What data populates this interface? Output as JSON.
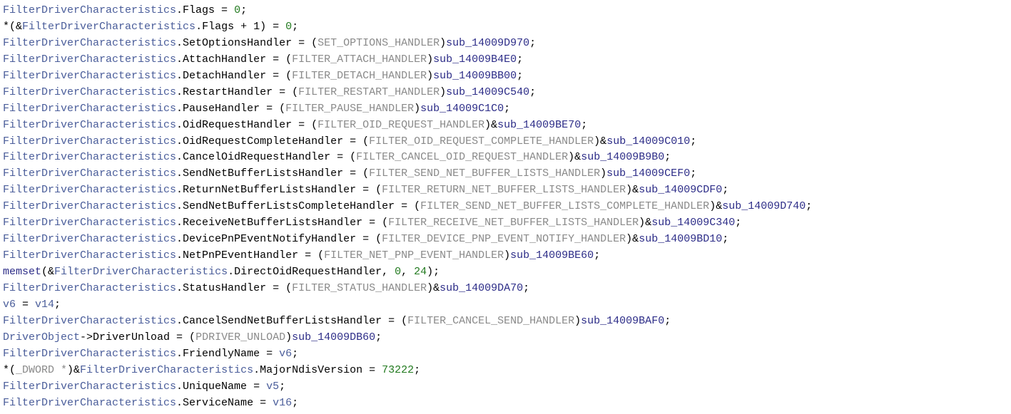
{
  "struct": "FilterDriverCharacteristics",
  "driverobj": "DriverObject",
  "lines": [
    {
      "kind": "assign_num",
      "member": "Flags",
      "value": "0"
    },
    {
      "kind": "ptr_store",
      "expr_pre": "*(&",
      "expr_post": ".Flags + 1) = ",
      "value": "0"
    },
    {
      "kind": "handler",
      "member": "SetOptionsHandler",
      "cast": "SET_OPTIONS_HANDLER",
      "amp": false,
      "sub": "sub_14009D970"
    },
    {
      "kind": "handler",
      "member": "AttachHandler",
      "cast": "FILTER_ATTACH_HANDLER",
      "amp": false,
      "sub": "sub_14009B4E0"
    },
    {
      "kind": "handler",
      "member": "DetachHandler",
      "cast": "FILTER_DETACH_HANDLER",
      "amp": false,
      "sub": "sub_14009BB00"
    },
    {
      "kind": "handler",
      "member": "RestartHandler",
      "cast": "FILTER_RESTART_HANDLER",
      "amp": false,
      "sub": "sub_14009C540"
    },
    {
      "kind": "handler",
      "member": "PauseHandler",
      "cast": "FILTER_PAUSE_HANDLER",
      "amp": false,
      "sub": "sub_14009C1C0"
    },
    {
      "kind": "handler",
      "member": "OidRequestHandler",
      "cast": "FILTER_OID_REQUEST_HANDLER",
      "amp": true,
      "sub": "sub_14009BE70"
    },
    {
      "kind": "handler",
      "member": "OidRequestCompleteHandler",
      "cast": "FILTER_OID_REQUEST_COMPLETE_HANDLER",
      "amp": true,
      "sub": "sub_14009C010"
    },
    {
      "kind": "handler",
      "member": "CancelOidRequestHandler",
      "cast": "FILTER_CANCEL_OID_REQUEST_HANDLER",
      "amp": true,
      "sub": "sub_14009B9B0"
    },
    {
      "kind": "handler",
      "member": "SendNetBufferListsHandler",
      "cast": "FILTER_SEND_NET_BUFFER_LISTS_HANDLER",
      "amp": false,
      "sub": "sub_14009CEF0"
    },
    {
      "kind": "handler",
      "member": "ReturnNetBufferListsHandler",
      "cast": "FILTER_RETURN_NET_BUFFER_LISTS_HANDLER",
      "amp": true,
      "sub": "sub_14009CDF0"
    },
    {
      "kind": "handler",
      "member": "SendNetBufferListsCompleteHandler",
      "cast": "FILTER_SEND_NET_BUFFER_LISTS_COMPLETE_HANDLER",
      "amp": true,
      "sub": "sub_14009D740"
    },
    {
      "kind": "handler",
      "member": "ReceiveNetBufferListsHandler",
      "cast": "FILTER_RECEIVE_NET_BUFFER_LISTS_HANDLER",
      "amp": true,
      "sub": "sub_14009C340"
    },
    {
      "kind": "handler",
      "member": "DevicePnPEventNotifyHandler",
      "cast": "FILTER_DEVICE_PNP_EVENT_NOTIFY_HANDLER",
      "amp": true,
      "sub": "sub_14009BD10"
    },
    {
      "kind": "handler",
      "member": "NetPnPEventHandler",
      "cast": "FILTER_NET_PNP_EVENT_HANDLER",
      "amp": false,
      "sub": "sub_14009BE60"
    },
    {
      "kind": "memset",
      "fn": "memset",
      "member": "DirectOidRequestHandler",
      "a2": "0",
      "a3": "24"
    },
    {
      "kind": "handler",
      "member": "StatusHandler",
      "cast": "FILTER_STATUS_HANDLER",
      "amp": true,
      "sub": "sub_14009DA70"
    },
    {
      "kind": "raw_ident",
      "lhs": "v6",
      "rhs": "v14"
    },
    {
      "kind": "handler",
      "member": "CancelSendNetBufferListsHandler",
      "cast": "FILTER_CANCEL_SEND_HANDLER",
      "amp": false,
      "sub": "sub_14009BAF0"
    },
    {
      "kind": "driver_unload",
      "member": "DriverUnload",
      "cast": "PDRIVER_UNLOAD",
      "sub": "sub_14009DB60"
    },
    {
      "kind": "assign_ident",
      "member": "FriendlyName",
      "rhs": "v6"
    },
    {
      "kind": "dword_store",
      "pre": "*(",
      "typecast": "_DWORD *",
      "member": "MajorNdisVersion",
      "value": "73222"
    },
    {
      "kind": "assign_ident",
      "member": "UniqueName",
      "rhs": "v5"
    },
    {
      "kind": "assign_ident",
      "member": "ServiceName",
      "rhs": "v16"
    }
  ]
}
